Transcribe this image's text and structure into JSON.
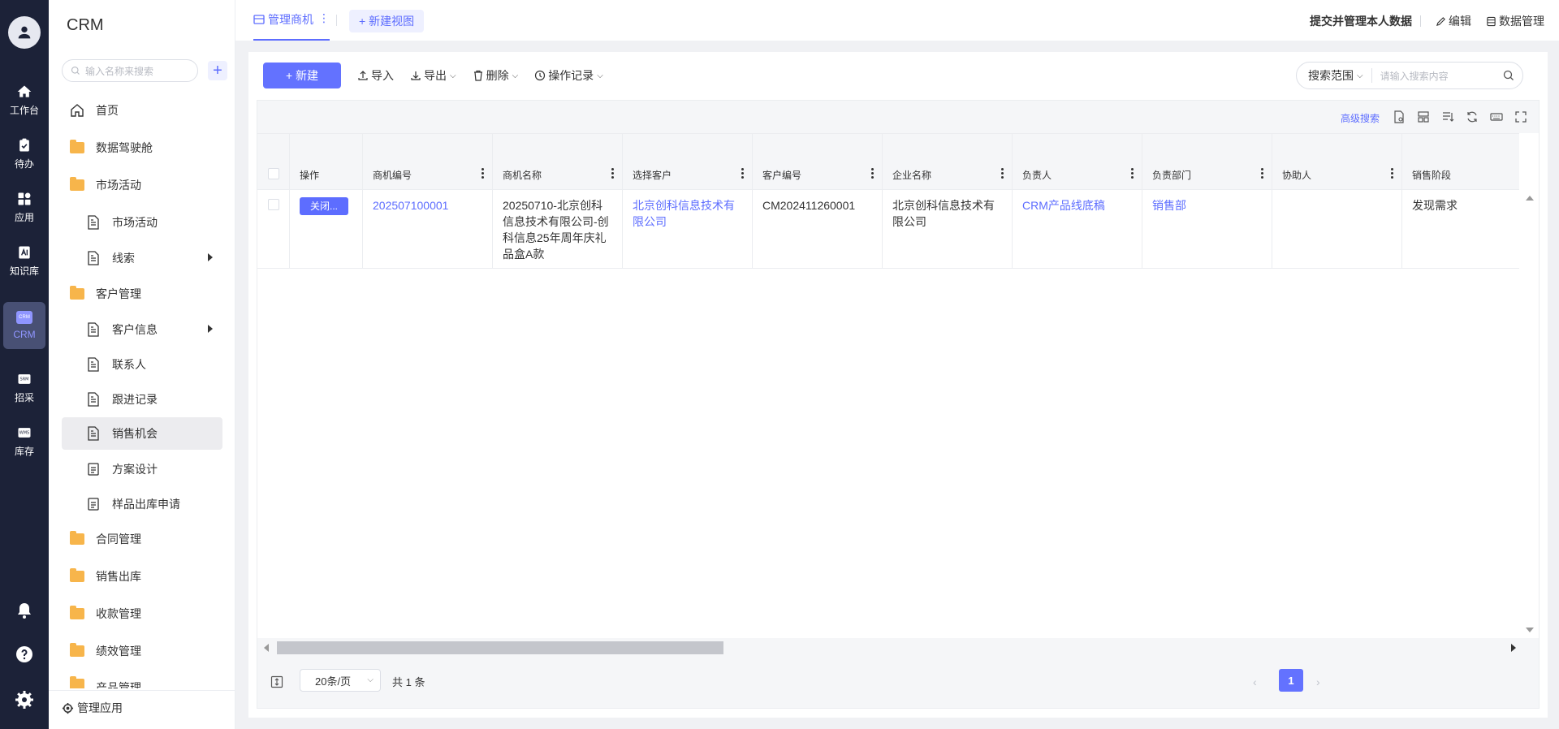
{
  "rail": {
    "items": [
      {
        "label": "工作台",
        "icon": "home-icon"
      },
      {
        "label": "待办",
        "icon": "todo-icon"
      },
      {
        "label": "应用",
        "icon": "apps-icon"
      },
      {
        "label": "知识库",
        "icon": "knowledge-icon"
      },
      {
        "label": "CRM",
        "icon": "crm-icon",
        "badge": "CRM"
      },
      {
        "label": "招采",
        "icon": "srm-icon",
        "badge": "SRM"
      },
      {
        "label": "库存",
        "icon": "wms-icon",
        "badge": "WMS"
      }
    ],
    "bottom_icons": [
      "bell-icon",
      "help-icon",
      "settings-icon"
    ]
  },
  "sidebar": {
    "title": "CRM",
    "search_placeholder": "输入名称来搜索",
    "add_label": "+",
    "items": [
      {
        "label": "首页"
      },
      {
        "label": "数据驾驶舱"
      },
      {
        "label": "市场活动"
      },
      {
        "label": "市场活动"
      },
      {
        "label": "线索"
      },
      {
        "label": "客户管理"
      },
      {
        "label": "客户信息"
      },
      {
        "label": "联系人"
      },
      {
        "label": "跟进记录"
      },
      {
        "label": "销售机会"
      },
      {
        "label": "方案设计"
      },
      {
        "label": "样品出库申请"
      },
      {
        "label": "合同管理"
      },
      {
        "label": "销售出库"
      },
      {
        "label": "收款管理"
      },
      {
        "label": "绩效管理"
      },
      {
        "label": "产品管理"
      }
    ],
    "manage_label": "管理应用"
  },
  "topbar": {
    "active_tab": "管理商机",
    "tab_more": "⋮",
    "new_view": "+ 新建视图",
    "submit_manage": "提交并管理本人数据",
    "edit": "编辑",
    "data_manage": "数据管理"
  },
  "toolbar": {
    "new": "+ 新建",
    "import": "导入",
    "export": "导出",
    "delete": "删除",
    "log": "操作记录",
    "search_scope": "搜索范围",
    "search_placeholder": "请输入搜索内容"
  },
  "table": {
    "advanced_search": "高级搜索",
    "columns": [
      "操作",
      "商机编号",
      "商机名称",
      "选择客户",
      "客户编号",
      "企业名称",
      "负责人",
      "负责部门",
      "协助人",
      "销售阶段"
    ],
    "rows": [
      {
        "action": "关闭...",
        "opportunity_no": "202507100001",
        "opportunity_name": "20250710-北京创科信息技术有限公司-创科信息25年周年庆礼品盒A款",
        "customer": "北京创科信息技术有限公司",
        "customer_no": "CM202411260001",
        "company": "北京创科信息技术有限公司",
        "owner": "CRM产品线底稿",
        "department": "销售部",
        "assistant": "",
        "stage": "发现需求"
      }
    ]
  },
  "pagination": {
    "page_size": "20条/页",
    "total": "共 1 条",
    "prev": "‹",
    "current": "1",
    "next": "›"
  },
  "colors": {
    "accent": "#5d6dff",
    "rail_bg": "#1c2238",
    "folder": "#f7b54b"
  }
}
